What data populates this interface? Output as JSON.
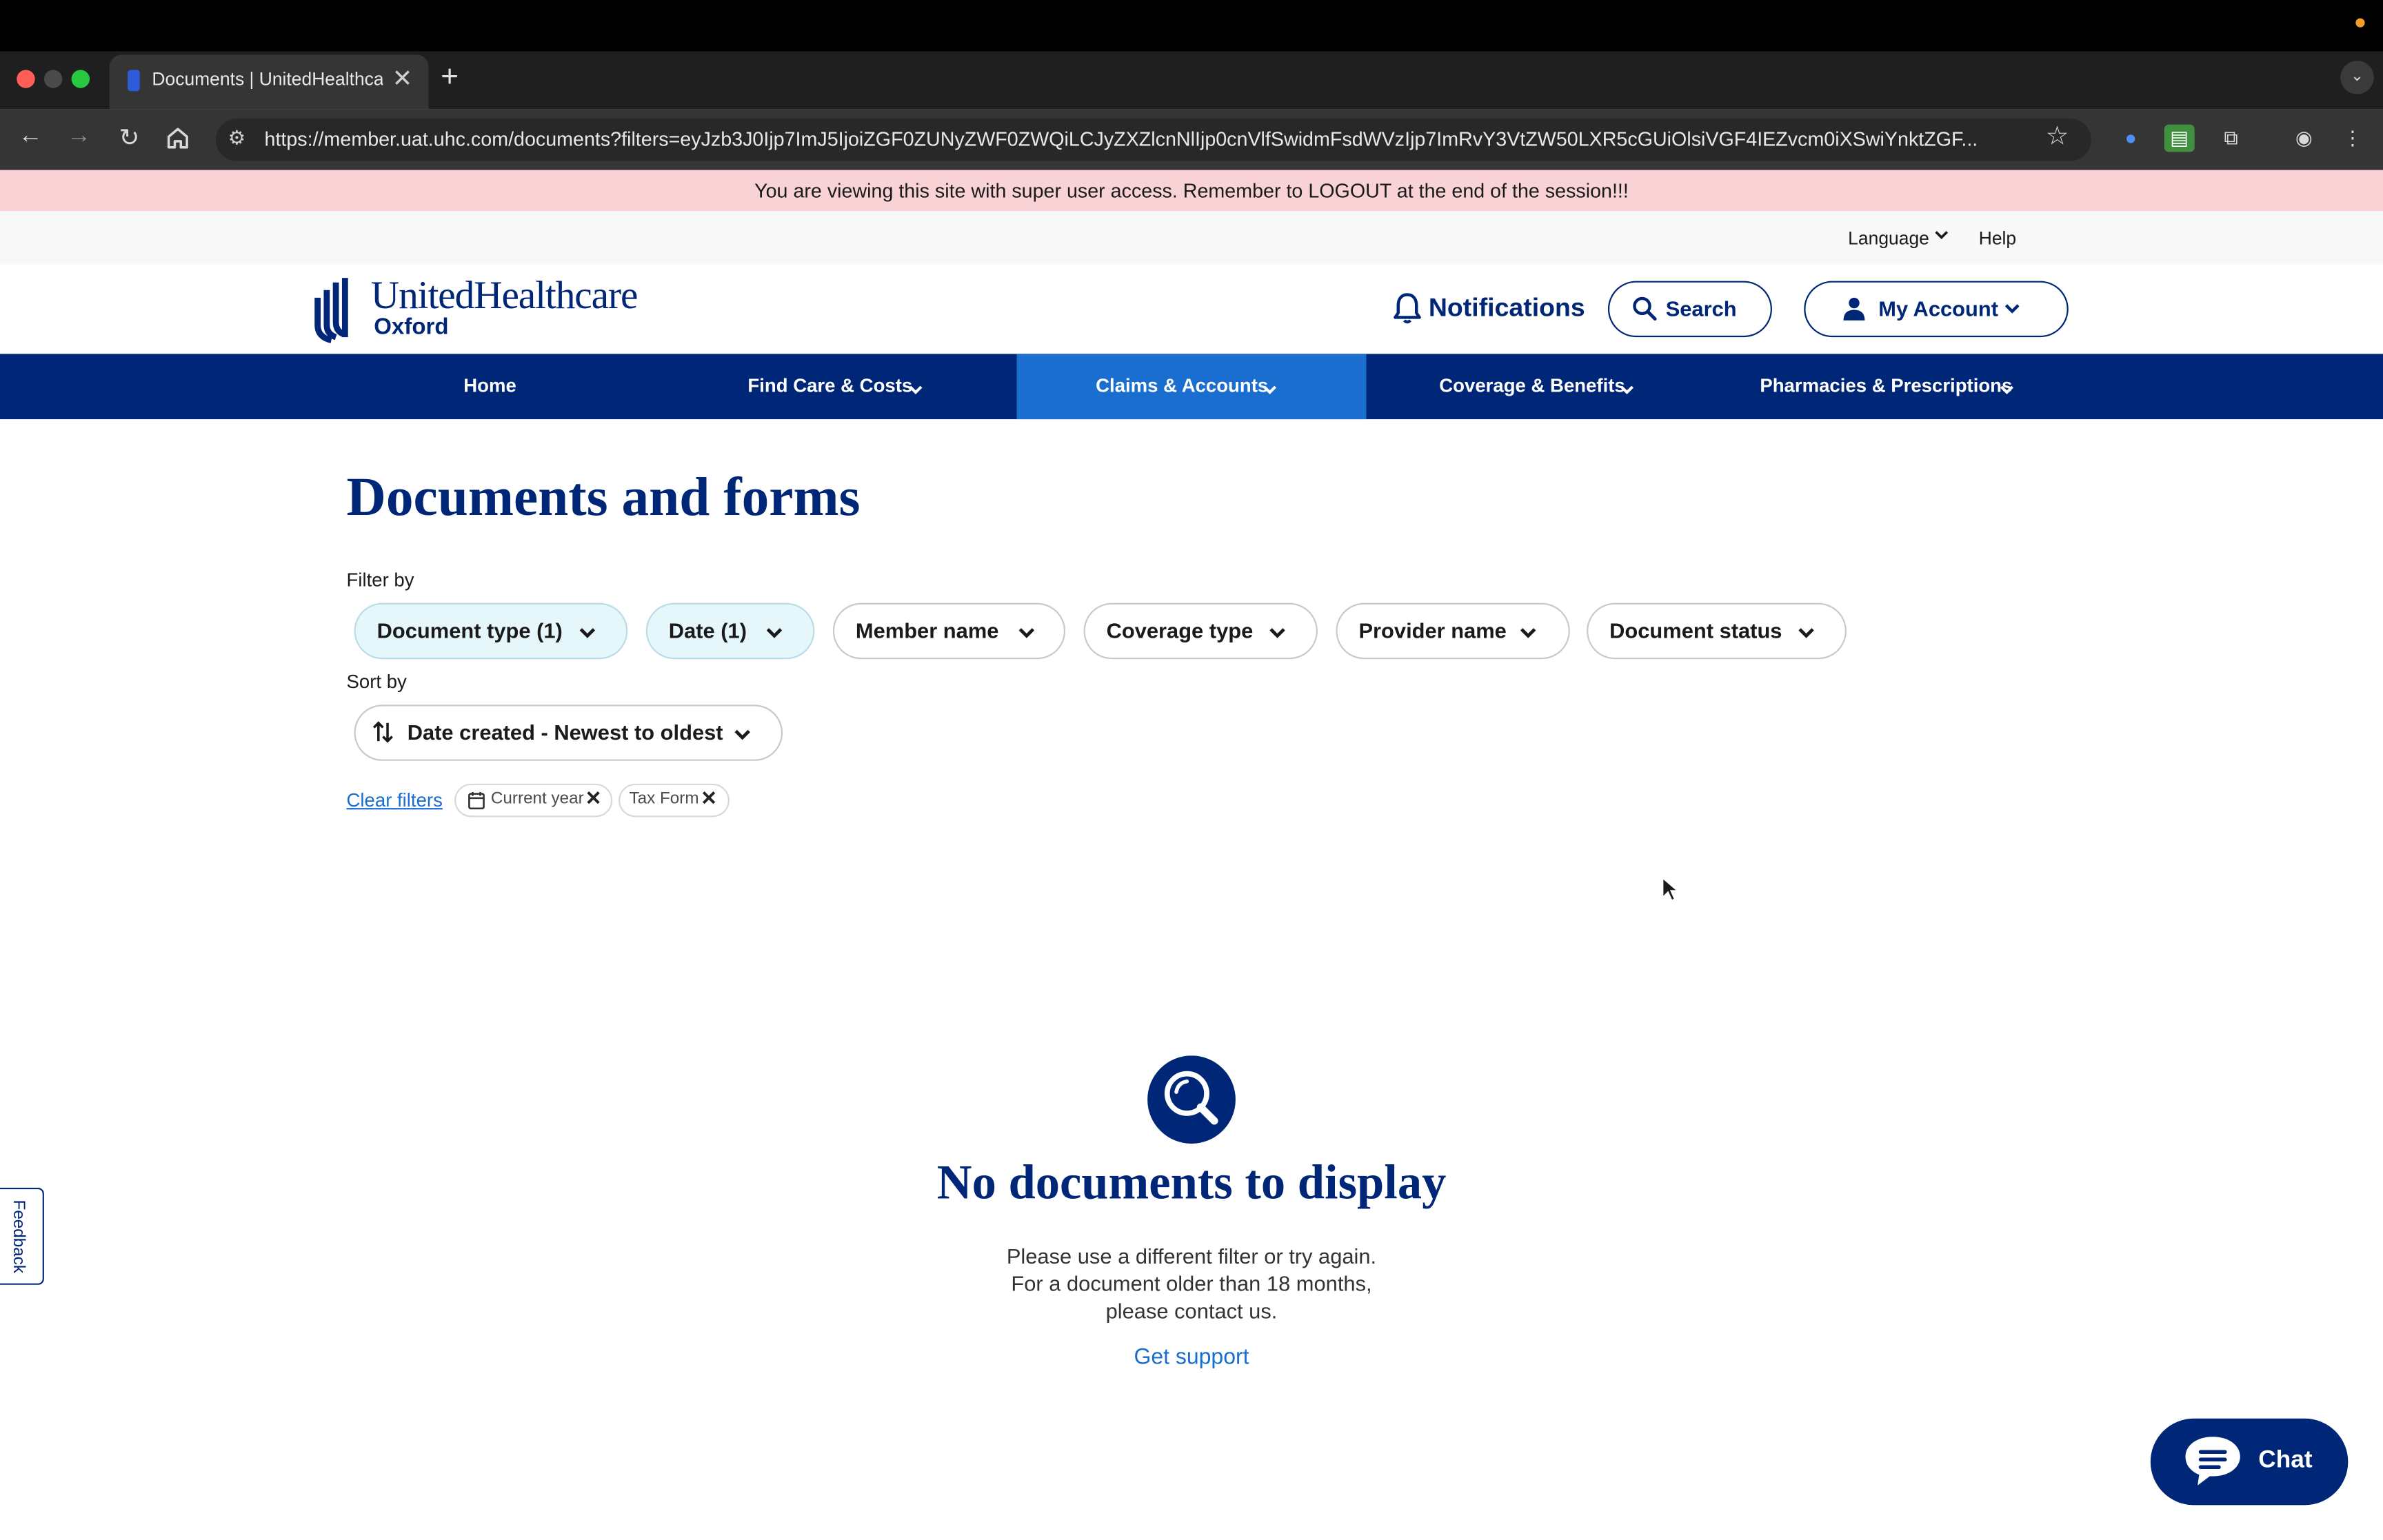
{
  "browser": {
    "tab_title": "Documents | UnitedHealthcare",
    "url": "https://member.uat.uhc.com/documents?filters=eyJzb3J0Ijp7ImJ5IjoiZGF0ZUNyZWF0ZWQiLCJyZXZlcnNlIjp0cnVlfSwidmFsdWVzIjp7ImRvY3VtZW50LXR5cGUiOlsiVGF4IEZvcm0iXSwiYnktZGF..."
  },
  "banner": {
    "text": "You are viewing this site with super user access. Remember to LOGOUT at the end of the session!!!"
  },
  "utility": {
    "language": "Language",
    "help": "Help"
  },
  "header": {
    "brand": "UnitedHealthcare",
    "brand_sub": "Oxford",
    "notifications": "Notifications",
    "search": "Search",
    "account": "My Account"
  },
  "nav": {
    "items": [
      {
        "label": "Home",
        "has_menu": false,
        "active": false
      },
      {
        "label": "Find Care & Costs",
        "has_menu": true,
        "active": false
      },
      {
        "label": "Claims & Accounts",
        "has_menu": true,
        "active": true
      },
      {
        "label": "Coverage & Benefits",
        "has_menu": true,
        "active": false
      },
      {
        "label": "Pharmacies & Prescriptions",
        "has_menu": true,
        "active": false
      }
    ]
  },
  "page": {
    "title": "Documents and forms",
    "filter_label": "Filter by",
    "filters": [
      {
        "label": "Document type (1)",
        "active": true
      },
      {
        "label": "Date (1)",
        "active": true
      },
      {
        "label": "Member name",
        "active": false
      },
      {
        "label": "Coverage type",
        "active": false
      },
      {
        "label": "Provider name",
        "active": false
      },
      {
        "label": "Document status",
        "active": false
      }
    ],
    "sort_label": "Sort by",
    "sort_value": "Date created - Newest to oldest",
    "clear_filters": "Clear filters",
    "chips": [
      {
        "label": "Current year",
        "icon": "calendar-icon"
      },
      {
        "label": "Tax Form",
        "icon": null
      }
    ]
  },
  "empty_state": {
    "title": "No documents to display",
    "lines": [
      "Please use a different filter or try again.",
      "For a document older than 18 months,",
      "please contact us."
    ],
    "link": "Get support"
  },
  "feedback": "Feedback",
  "chat": "Chat",
  "colors": {
    "brand_navy": "#002677",
    "nav_active_blue": "#196ecf",
    "banner_pink": "#f9d2d6",
    "filter_active_bg": "#e5f7fb"
  }
}
